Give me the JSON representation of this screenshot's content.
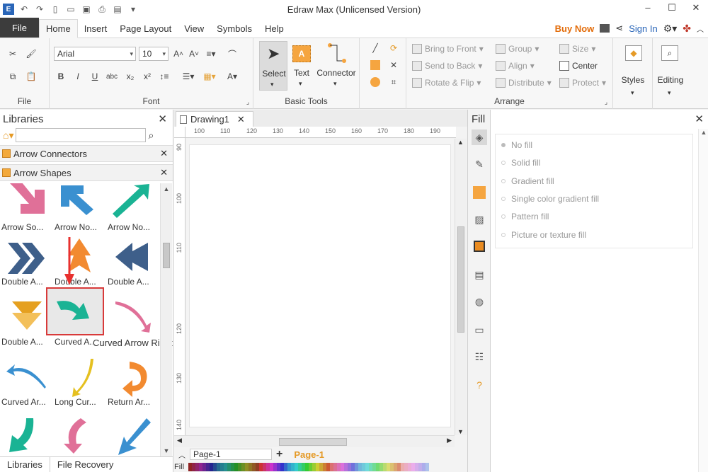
{
  "window": {
    "title": "Edraw Max (Unlicensed Version)"
  },
  "menu": {
    "file": "File",
    "tabs": [
      "Home",
      "Insert",
      "Page Layout",
      "View",
      "Symbols",
      "Help"
    ],
    "buy_now": "Buy Now",
    "sign_in": "Sign In"
  },
  "ribbon": {
    "file_group": "File",
    "font_group": "Font",
    "font_name": "Arial",
    "font_size": "10",
    "basic_tools_group": "Basic Tools",
    "select": "Select",
    "text": "Text",
    "connector": "Connector",
    "arrange_group": "Arrange",
    "bring_to_front": "Bring to Front",
    "send_to_back": "Send to Back",
    "rotate_flip": "Rotate & Flip",
    "group": "Group",
    "align": "Align",
    "distribute": "Distribute",
    "size": "Size",
    "center": "Center",
    "protect": "Protect",
    "styles": "Styles",
    "editing": "Editing"
  },
  "libraries": {
    "title": "Libraries",
    "categories": [
      "Arrow Connectors",
      "Arrow Shapes"
    ],
    "shapes": [
      {
        "label": "Arrow So..."
      },
      {
        "label": "Arrow No..."
      },
      {
        "label": "Arrow No..."
      },
      {
        "label": "Double A..."
      },
      {
        "label": "Double A..."
      },
      {
        "label": "Double A..."
      },
      {
        "label": "Double A..."
      },
      {
        "label": "Curved A..."
      },
      {
        "label": ""
      },
      {
        "label": "Curved Ar..."
      },
      {
        "label": "Long Cur..."
      },
      {
        "label": "Return Ar..."
      },
      {
        "label": ""
      },
      {
        "label": ""
      },
      {
        "label": ""
      }
    ],
    "tooltip": "Curved Arrow Right",
    "bottom_tabs": [
      "Libraries",
      "File Recovery"
    ]
  },
  "document": {
    "tab": "Drawing1",
    "ruler_h": [
      "100",
      "110",
      "120",
      "130",
      "140",
      "150",
      "160",
      "170",
      "180",
      "190"
    ],
    "ruler_v": [
      "90",
      "100",
      "110",
      "120",
      "130",
      "140"
    ],
    "page_select": "Page-1",
    "page_tab": "Page-1",
    "fill_label": "Fill"
  },
  "fill_panel": {
    "title": "Fill",
    "options": [
      "No fill",
      "Solid fill",
      "Gradient fill",
      "Single color gradient fill",
      "Pattern fill",
      "Picture or texture fill"
    ]
  },
  "colors": {
    "accent": "#e59a27",
    "brand_orange": "#e36c0a",
    "selection_red": "#d83a3a",
    "teal": "#1ab394",
    "pink": "#e07098",
    "blue": "#3a90d0"
  }
}
